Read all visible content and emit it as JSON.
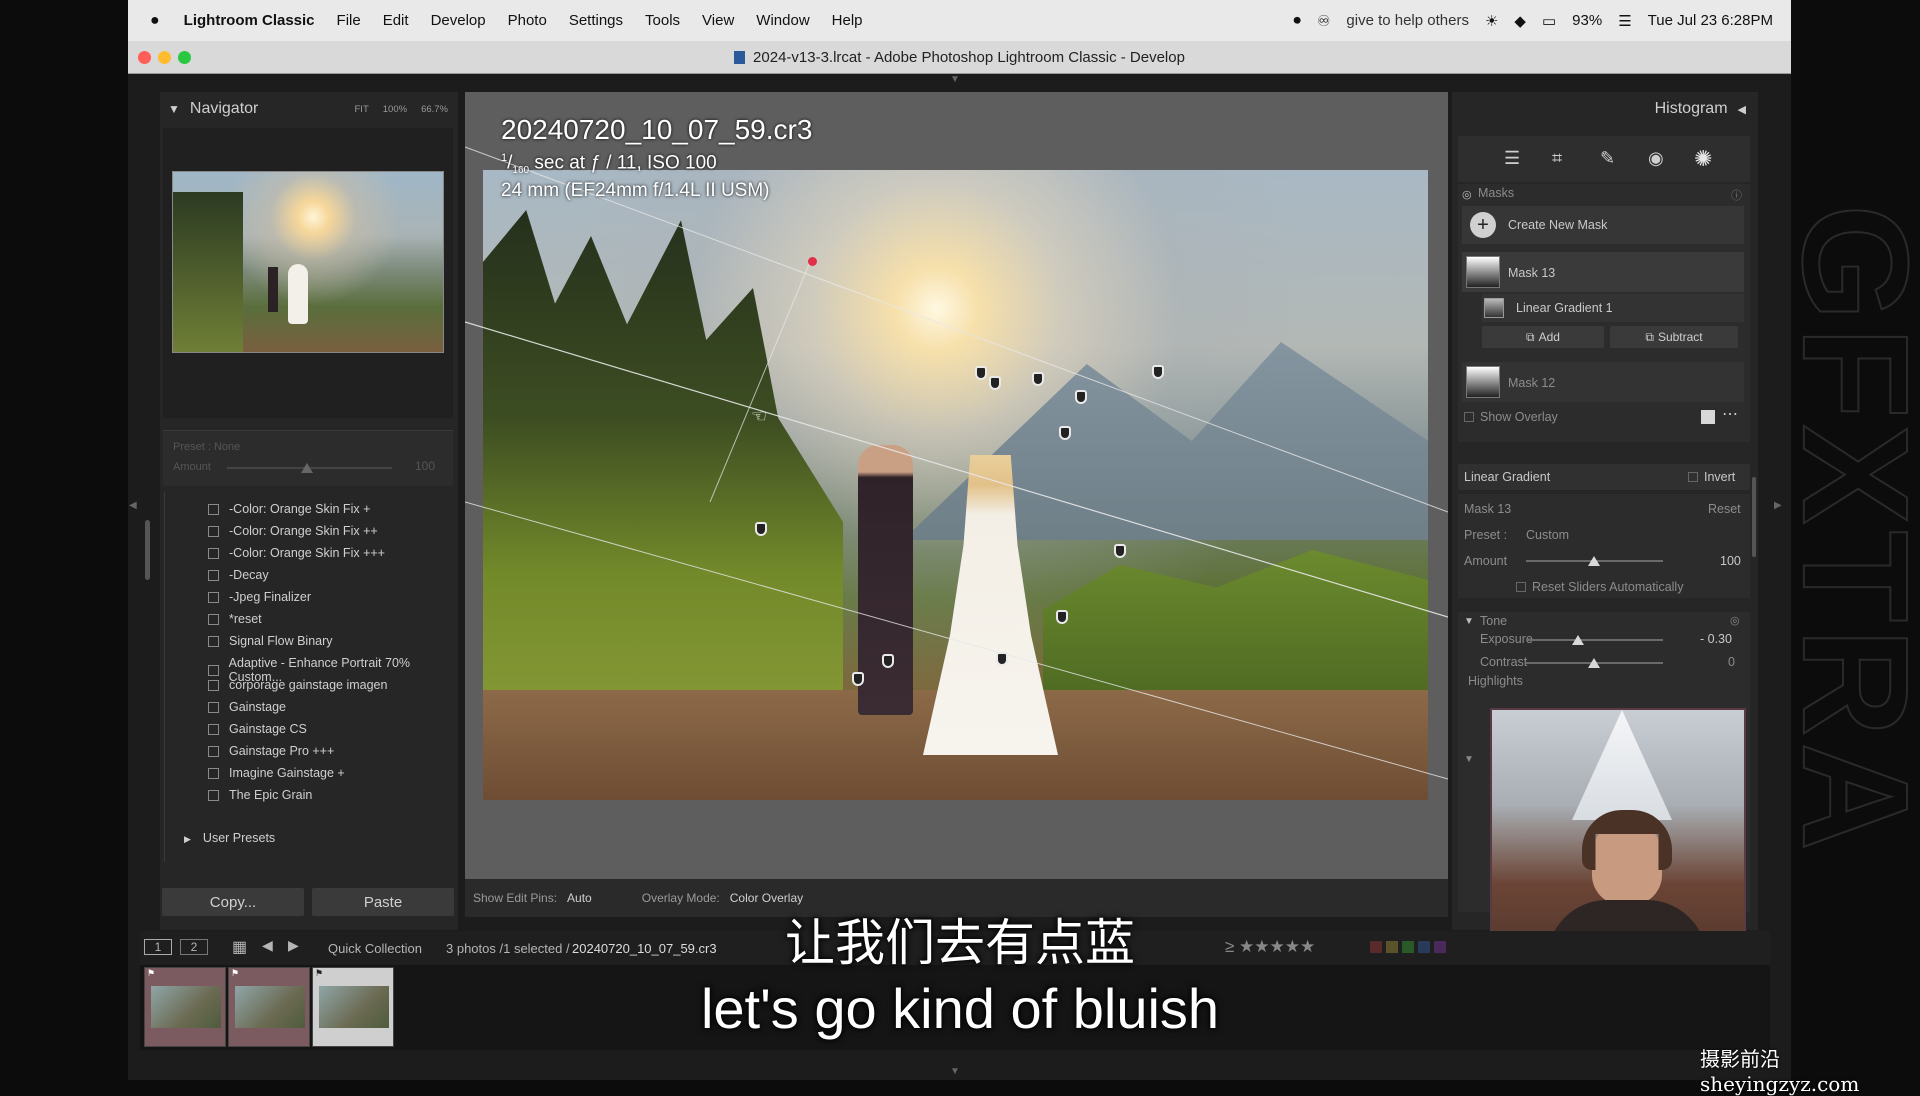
{
  "menubar": {
    "app_name": "Lightroom Classic",
    "items": [
      "File",
      "Edit",
      "Develop",
      "Photo",
      "Settings",
      "Tools",
      "View",
      "Window",
      "Help"
    ],
    "status_text": "give to help others",
    "battery": "93%",
    "datetime": "Tue Jul 23  6:28PM"
  },
  "window": {
    "title": "2024-v13-3.lrcat - Adobe Photoshop Lightroom Classic - Develop"
  },
  "navigator": {
    "title": "Navigator",
    "zoom_options": [
      "FIT",
      "100%",
      "66.7%"
    ],
    "preset_label": "Preset : None",
    "amount_label": "Amount",
    "amount_value": "100"
  },
  "presets": {
    "items": [
      "-Color: Orange Skin Fix +",
      "-Color: Orange Skin Fix ++",
      "-Color: Orange Skin Fix +++",
      "-Decay",
      "-Jpeg Finalizer",
      "*reset",
      "Signal Flow Binary",
      "Adaptive - Enhance Portrait 70% Custom...",
      "corporage gainstage imagen",
      "Gainstage",
      "Gainstage CS",
      "Gainstage Pro +++",
      "Imagine Gainstage  +",
      "The Epic Grain"
    ],
    "user_presets": "User Presets"
  },
  "left_buttons": {
    "copy": "Copy...",
    "paste": "Paste"
  },
  "photo": {
    "filename": "20240720_10_07_59.cr3",
    "shutter_num": "1",
    "shutter_den": "160",
    "exposure_rest": " sec at ƒ / 11, ISO 100",
    "lens": "24 mm (EF24mm f/1.4L II USM)"
  },
  "toolbar": {
    "edit_pins_label": "Show Edit Pins:",
    "edit_pins_value": "Auto",
    "overlay_mode_label": "Overlay Mode:",
    "overlay_mode_value": "Color Overlay"
  },
  "right_panel": {
    "histogram": "Histogram",
    "masks_label": "Masks",
    "create_mask": "Create New Mask",
    "mask13": "Mask 13",
    "linear_gradient_item": "Linear Gradient 1",
    "add": "Add",
    "subtract": "Subtract",
    "mask12": "Mask 12",
    "show_overlay": "Show Overlay",
    "linear_gradient_header": "Linear Gradient",
    "invert": "Invert",
    "mask13_sub": "Mask 13",
    "reset": "Reset",
    "preset_label": "Preset :",
    "preset_value": "Custom",
    "amount_label": "Amount",
    "amount_value": "100",
    "reset_sliders": "Reset Sliders Automatically",
    "tone": "Tone",
    "exposure_label": "Exposure",
    "exposure_value": "- 0.30",
    "contrast_label": "Contrast",
    "contrast_value": "0",
    "highlights_label": "Highlights"
  },
  "filmbar": {
    "pages": [
      "1",
      "2"
    ],
    "source": "Quick Collection",
    "count": "3 photos /1 selected /",
    "selected_file": "20240720_10_07_59.cr3"
  },
  "subtitles": {
    "chinese": "让我们去有点蓝",
    "english": "let's go kind of bluish"
  },
  "watermark": {
    "vertical": "GFXTRA",
    "site": "摄影前沿 sheyingzyz.com"
  },
  "colors": {
    "panel_bg": "#262626",
    "accent_white": "#eaeaea",
    "red_pin": "#e0304a"
  }
}
